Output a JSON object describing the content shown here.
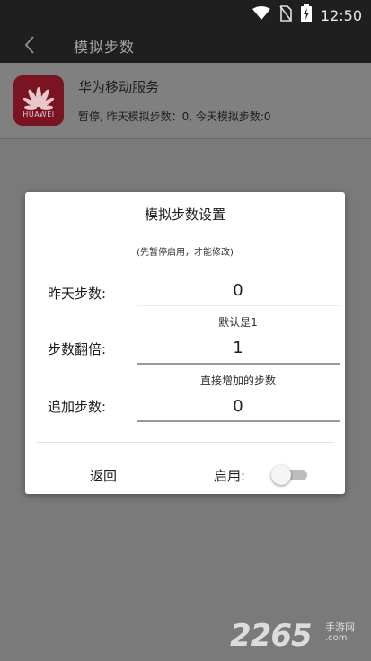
{
  "status_bar": {
    "time": "12:50",
    "icons": [
      "wifi-icon",
      "no-sim-icon",
      "battery-charging-icon"
    ]
  },
  "toolbar": {
    "title": "模拟步数",
    "back_icon": "chevron-left-icon"
  },
  "service": {
    "logo_text": "HUAWEI",
    "name": "华为移动服务",
    "status": "暂停, 昨天模拟步数：0, 今天模拟步数:0"
  },
  "dialog": {
    "title": "模拟步数设置",
    "hint": "(先暂停启用，才能修改)",
    "yesterday_label": "昨天步数:",
    "yesterday_value": "0",
    "multiplier_hint": "默认是1",
    "multiplier_label": "步数翻倍:",
    "multiplier_value": "1",
    "add_hint": "直接增加的步数",
    "add_label": "追加步数:",
    "add_value": "0",
    "return_label": "返回",
    "enable_label": "启用:",
    "enable_on": false
  },
  "watermark": {
    "number": "2265",
    "site": "手游网",
    "domain": ".com"
  },
  "colors": {
    "bar": "#1f1f1f",
    "overlay": "#7a7a7a",
    "dialog": "#ffffff",
    "huawei_red": "#7a1322"
  }
}
